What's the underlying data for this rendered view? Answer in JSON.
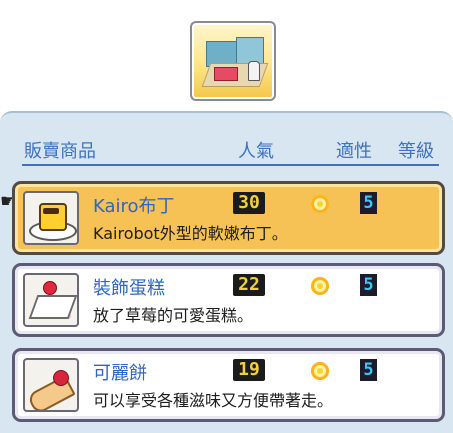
{
  "header": {
    "col_item": "販賣商品",
    "col_popularity": "人氣",
    "col_aptitude": "適性",
    "col_level": "等級"
  },
  "items": [
    {
      "name": "Kairo布丁",
      "desc": "Kairobot外型的軟嫩布丁。",
      "popularity": "30",
      "level": "5",
      "thumb_icon": "pudding-icon",
      "selected": true
    },
    {
      "name": "裝飾蛋糕",
      "desc": "放了草莓的可愛蛋糕。",
      "popularity": "22",
      "level": "5",
      "thumb_icon": "cake-icon",
      "selected": false
    },
    {
      "name": "可麗餅",
      "desc": "可以享受各種滋味又方便帶著走。",
      "popularity": "19",
      "level": "5",
      "thumb_icon": "crepe-icon",
      "selected": false
    }
  ],
  "colors": {
    "accent": "#3c72c0",
    "selected_bg": "#f7c255",
    "panel_bg": "#d7e6f1"
  }
}
